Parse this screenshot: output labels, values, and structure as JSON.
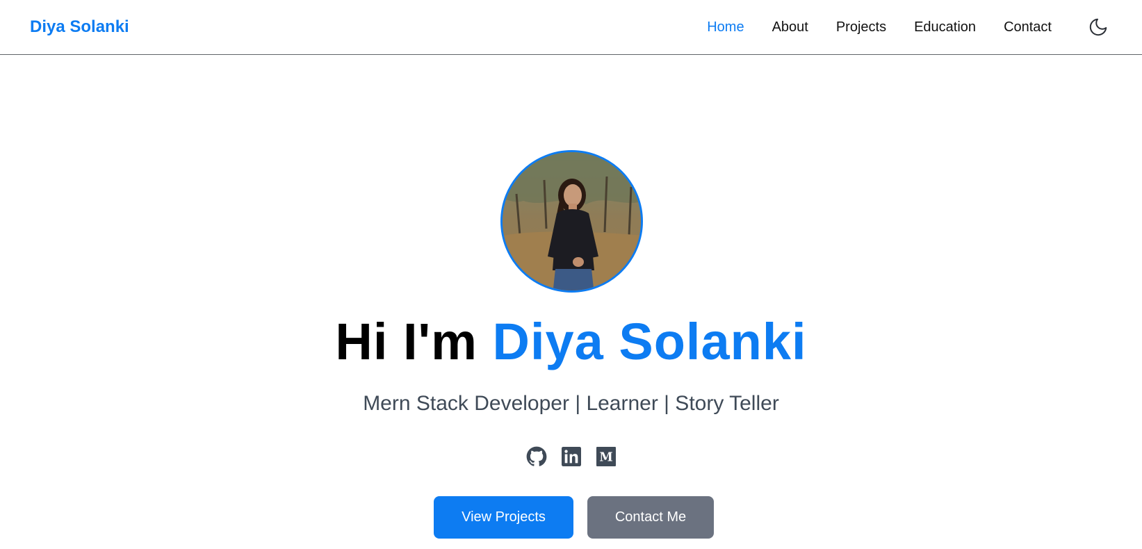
{
  "header": {
    "brand": "Diya Solanki",
    "nav": [
      {
        "label": "Home",
        "active": true
      },
      {
        "label": "About",
        "active": false
      },
      {
        "label": "Projects",
        "active": false
      },
      {
        "label": "Education",
        "active": false
      },
      {
        "label": "Contact",
        "active": false
      }
    ],
    "theme_toggle_icon": "moon-icon"
  },
  "hero": {
    "avatar_alt": "profile-photo",
    "title_prefix": "Hi I'm",
    "title_name": "Diya Solanki",
    "subtitle": "Mern Stack Developer | Learner | Story Teller",
    "socials": [
      {
        "icon": "github-icon"
      },
      {
        "icon": "linkedin-icon"
      },
      {
        "icon": "medium-icon"
      }
    ],
    "primary_button": "View Projects",
    "secondary_button": "Contact Me"
  },
  "colors": {
    "accent": "#0d7cf2",
    "secondary_button": "#6b7280",
    "subtitle": "#3f4a57",
    "icon": "#3f4a57"
  }
}
